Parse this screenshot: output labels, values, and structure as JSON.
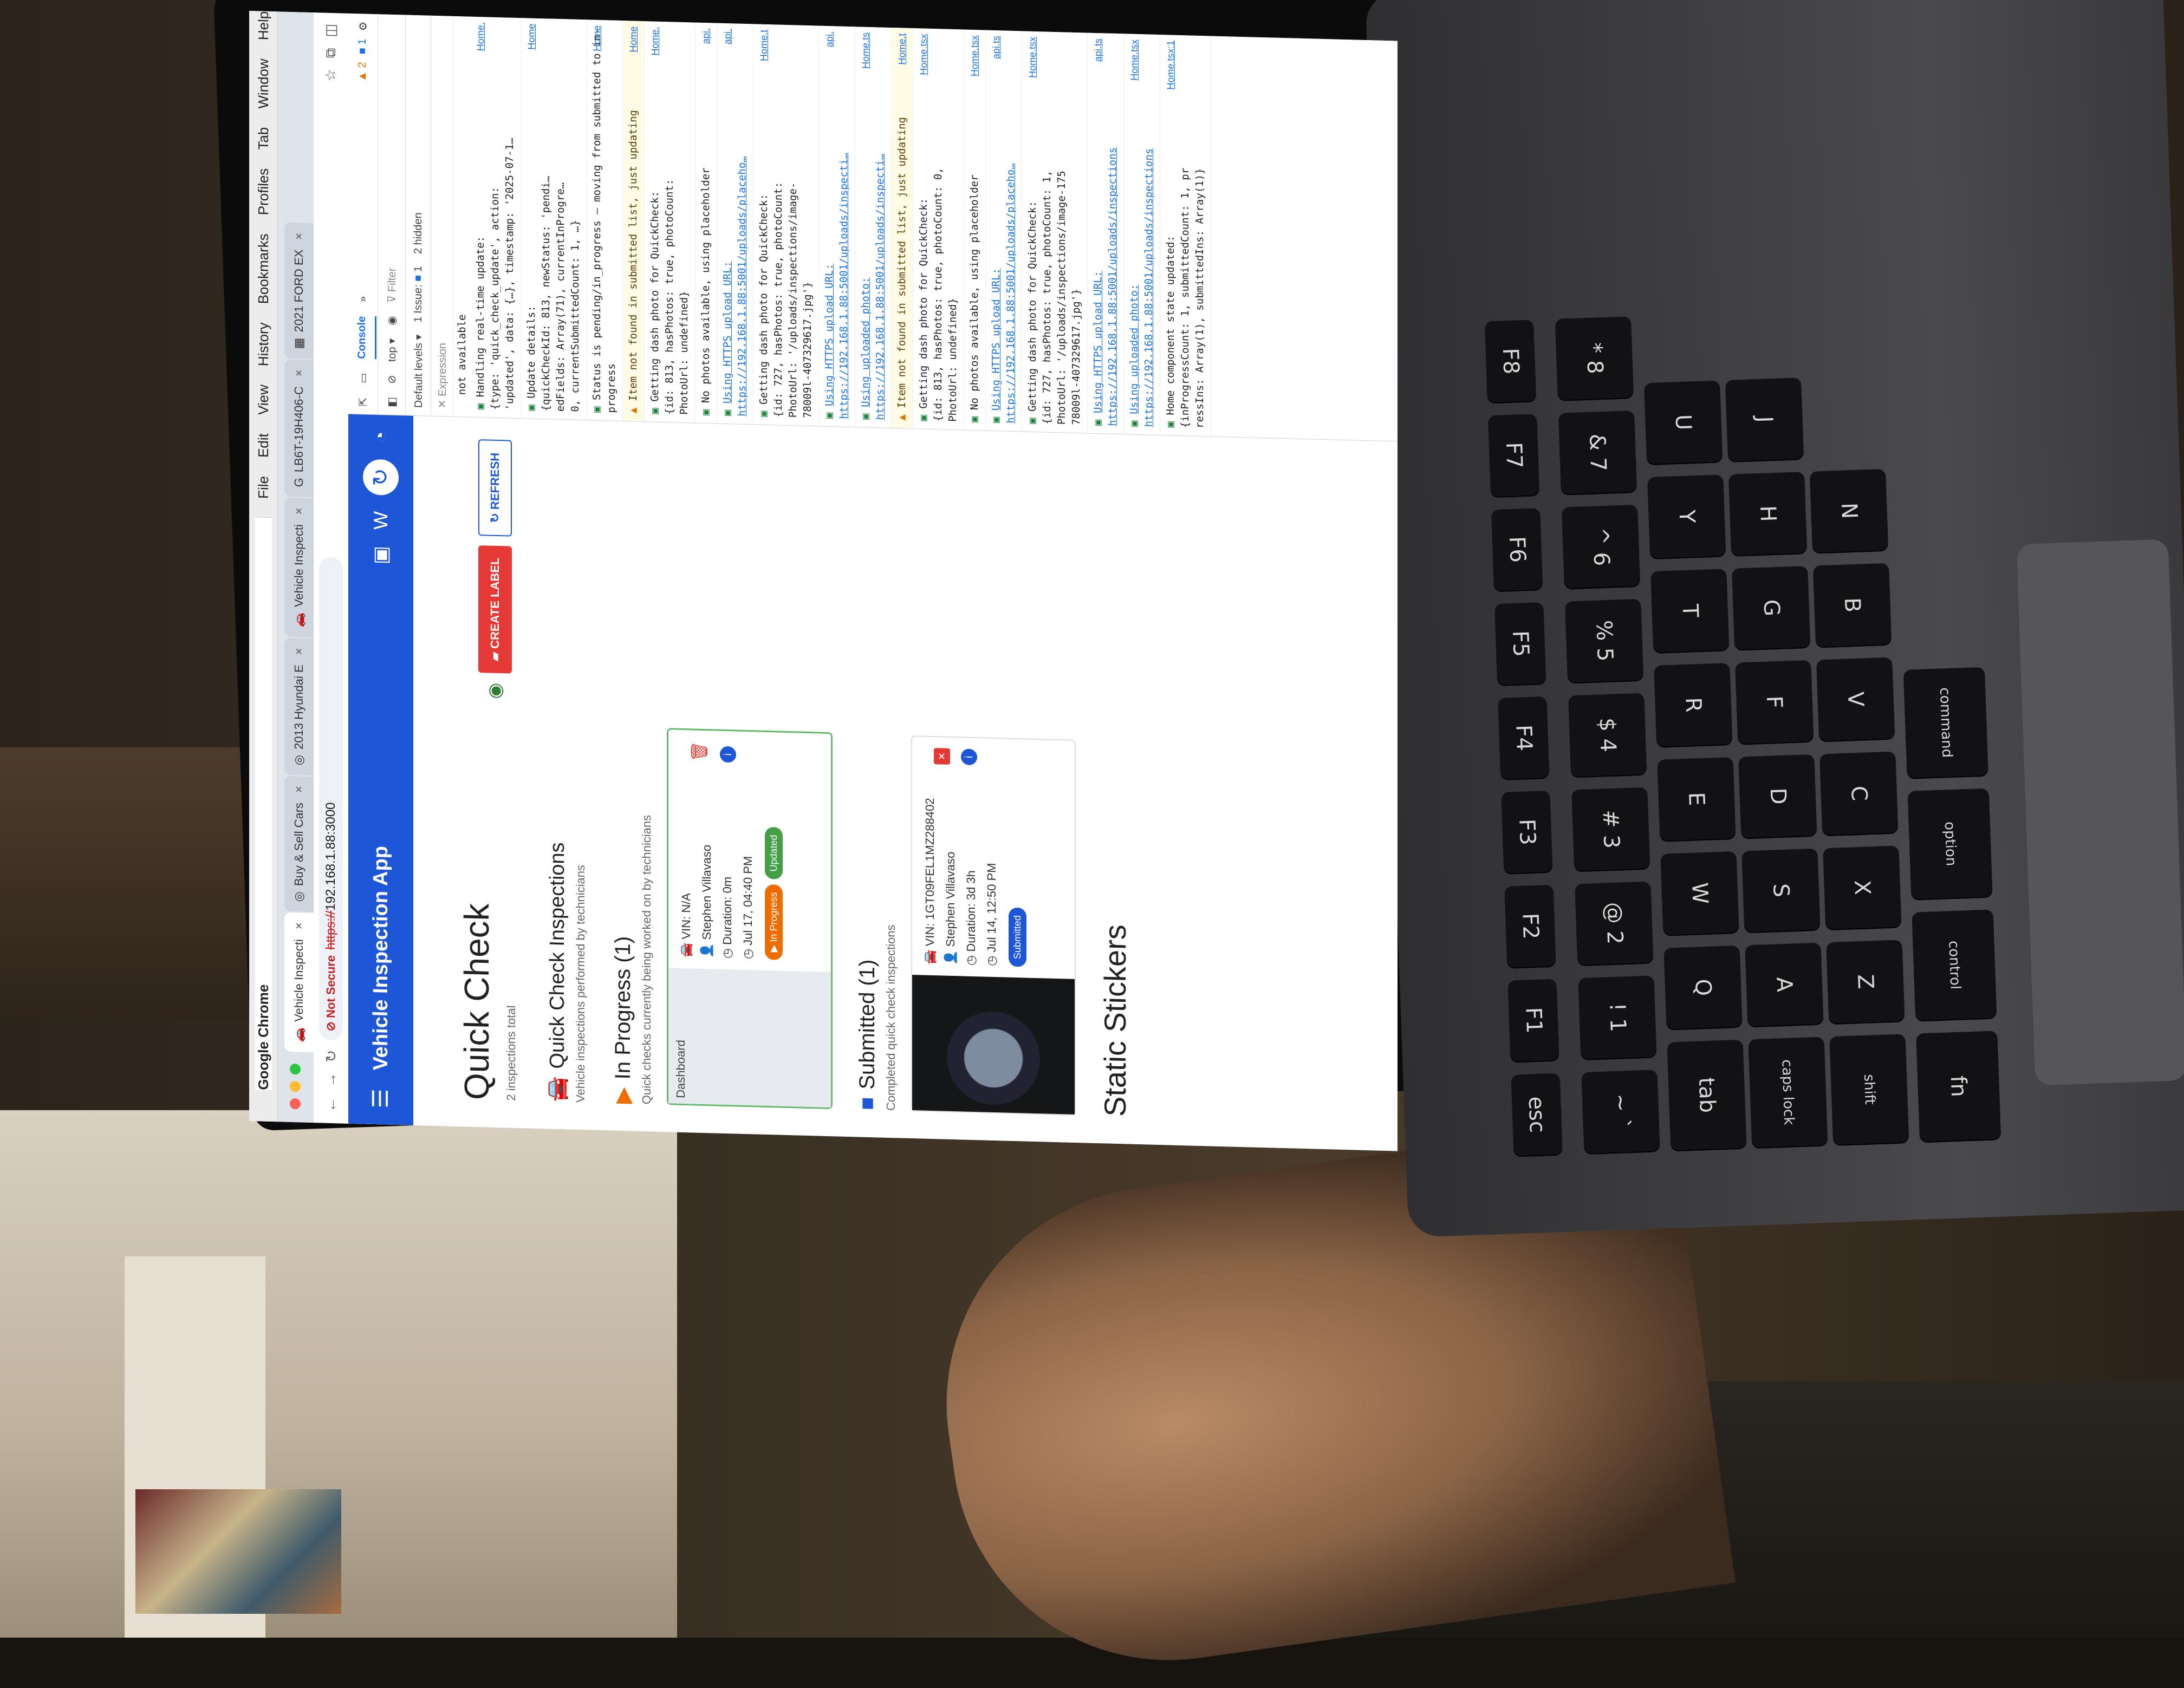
{
  "mac_menu": [
    "Google Chrome",
    "File",
    "Edit",
    "View",
    "History",
    "Bookmarks",
    "Profiles",
    "Tab",
    "Window",
    "Help"
  ],
  "tabs": [
    {
      "label": "Vehicle Inspecti",
      "active": true
    },
    {
      "label": "Buy & Sell Cars",
      "active": false
    },
    {
      "label": "2013 Hyundai E",
      "active": false
    },
    {
      "label": "Vehicle Inspecti",
      "active": false
    },
    {
      "label": "LB6T-19H406-C",
      "active": false
    },
    {
      "label": "2021 FORD EX",
      "active": false
    }
  ],
  "address": {
    "security": "Not Secure",
    "scheme": "https://",
    "host": "192.168.1.88:3000"
  },
  "app": {
    "title": "Vehicle Inspection App",
    "page_title": "Quick Check",
    "total": "2 inspections total",
    "create_label": "CREATE LABEL",
    "refresh": "REFRESH",
    "section_title": "Quick Check Inspections",
    "section_sub": "Vehicle inspections performed by technicians",
    "in_progress": {
      "title": "In Progress (1)",
      "subtitle": "Quick checks currently being worked on by technicians",
      "card": {
        "thumb_label": "Dashboard",
        "vin": "VIN: N/A",
        "tech": "Stephen Villavaso",
        "duration": "Duration: 0m",
        "date": "Jul 17, 04:40 PM",
        "status": "In Progress",
        "badge": "Updated"
      }
    },
    "submitted": {
      "title": "Submitted (1)",
      "subtitle": "Completed quick check inspections",
      "card": {
        "vin": "VIN: 1GT09FEL1MZ288402",
        "tech": "Stephen Villavaso",
        "duration": "Duration: 3d 3h",
        "date": "Jul 14, 12:50 PM",
        "status": "Submitted"
      }
    },
    "static_title": "Static Stickers"
  },
  "devtools": {
    "tab": "Console",
    "warnings": "2",
    "errors": "1",
    "context": "top",
    "filter": "Filter",
    "levels": "Default levels",
    "issues": "1 Issue:",
    "issue_count": "1",
    "hidden": "2 hidden",
    "expression_label": "Expression",
    "expression_value": "not available",
    "logs": [
      {
        "text": "Handling real-time update:\n{type: 'quick_check_update', action:\n'updated', data: {…}, timestamp: '2025-07-1…",
        "src": "Home.",
        "kind": "info"
      },
      {
        "text": "Update details:\n{quickCheckId: 813, newStatus: 'pendi…\nedFields: Array(71), currentInProgre…\n0, currentSubmittedCount: 1, …}",
        "src": "Home",
        "kind": "info"
      },
      {
        "text": "Status is pending/in_progress – moving from submitted to in-progress",
        "src": "Home",
        "kind": "info"
      },
      {
        "text": "Item not found in submitted list, just updating",
        "src": "Home",
        "kind": "warn"
      },
      {
        "text": "Getting dash photo for QuickCheck:\n{id: 813, hasPhotos: true, photoCount:\nPhotoUrl: undefined}",
        "src": "Home.",
        "kind": "info"
      },
      {
        "text": "No photos available, using placeholder",
        "src": "api.",
        "kind": "info"
      },
      {
        "text": "Using HTTPS upload URL:\nhttps://192.168.1.88:5001/uploads/placeho…",
        "src": "api.",
        "kind": "link"
      },
      {
        "text": "Getting dash photo for QuickCheck:\n{id: 727, hasPhotos: true, photoCount:\nPhotoUrl: '/uploads/inspections/image-\n78009l-407329617.jpg'}",
        "src": "Home.t",
        "kind": "info"
      },
      {
        "text": "Using HTTPS upload URL:\nhttps://192.168.1.88:5001/uploads/inspecti…",
        "src": "api.",
        "kind": "link"
      },
      {
        "text": "Using uploaded photo:\nhttps://192.168.1.88:5001/uploads/inspecti…",
        "src": "Home.ts",
        "kind": "link"
      },
      {
        "text": "Item not found in submitted list, just updating",
        "src": "Home.t",
        "kind": "warn"
      },
      {
        "text": "Getting dash photo for QuickCheck:\n{id: 813, hasPhotos: true, photoCount: 0,\nPhotoUrl: undefined}",
        "src": "Home.tsx",
        "kind": "info"
      },
      {
        "text": "No photos available, using placeholder",
        "src": "Home.tsx",
        "kind": "info"
      },
      {
        "text": "Using HTTPS upload URL:\nhttps://192.168.1.88:5001/uploads/placeho…",
        "src": "api.ts",
        "kind": "link"
      },
      {
        "text": "Getting dash photo for QuickCheck:\n{id: 727, hasPhotos: true, photoCount: 1,\nPhotoUrl: '/uploads/inspections/image-175\n78009l-407329617.jpg'}",
        "src": "Home.tsx",
        "kind": "info"
      },
      {
        "text": "Using HTTPS upload URL:\nhttps://192.168.1.88:5001/uploads/inspections",
        "src": "api.ts",
        "kind": "link"
      },
      {
        "text": "Using uploaded photo:\nhttps://192.168.1.88:5001/uploads/inspections",
        "src": "Home.tsx",
        "kind": "link"
      },
      {
        "text": "Home component state updated:\n{inProgressCount: 1, submittedCount: 1, pr\nressIns: Array(1), submittedIns: Array(1)}",
        "src": "Home.tsx:1",
        "kind": "info"
      }
    ]
  },
  "keyboard_rows": [
    [
      "esc",
      "F1",
      "F2",
      "F3",
      "F4",
      "F5",
      "F6",
      "F7",
      "F8"
    ],
    [
      "~\n`",
      "!\n1",
      "@\n2",
      "#\n3",
      "$\n4",
      "%\n5",
      "^\n6",
      "&\n7",
      "*\n8"
    ],
    [
      "tab",
      "Q",
      "W",
      "E",
      "R",
      "T",
      "Y",
      "U"
    ],
    [
      "caps lock",
      "A",
      "S",
      "D",
      "F",
      "G",
      "H",
      "J"
    ],
    [
      "shift",
      "Z",
      "X",
      "C",
      "V",
      "B",
      "N"
    ],
    [
      "fn",
      "control",
      "option",
      "command"
    ]
  ]
}
